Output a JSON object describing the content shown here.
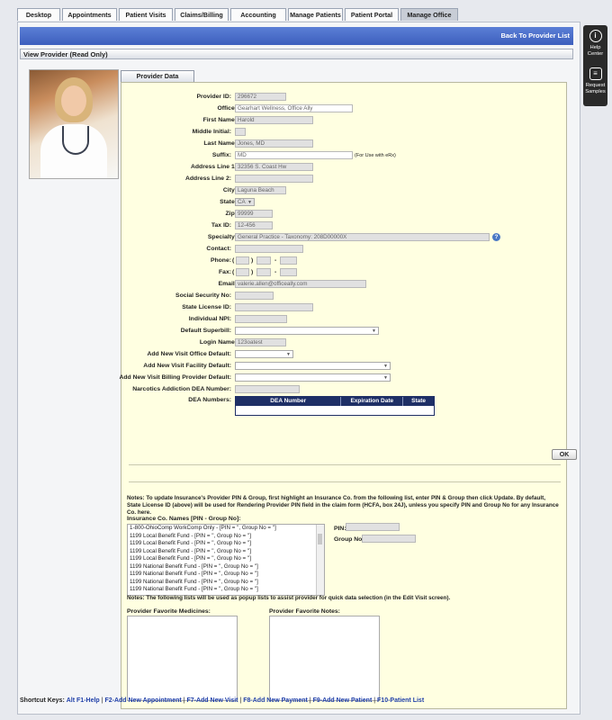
{
  "tabs": [
    "Desktop",
    "Appointments",
    "Patient Visits",
    "Claims/Billing",
    "Accounting",
    "Manage Patients",
    "Patient Portal",
    "Manage Office"
  ],
  "header": {
    "back_label": "Back To Provider List"
  },
  "section_title": "View Provider (Read Only)",
  "panel_tab": "Provider Data",
  "form": {
    "provider_id": {
      "label": "Provider ID:",
      "value": "296672"
    },
    "office": {
      "label": "Office:",
      "value": "Gearhart Wellness, Office Ally"
    },
    "first_name": {
      "label": "First Name:",
      "value": "Harold"
    },
    "middle_initial": {
      "label": "Middle Initial:",
      "value": ""
    },
    "last_name": {
      "label": "Last Name:",
      "value": "Jones, MD"
    },
    "suffix": {
      "label": "Suffix:",
      "value": "MD",
      "note": "(For Use with eRx)"
    },
    "address1": {
      "label": "Address Line 1:",
      "value": "32356 S. Coast Hw"
    },
    "address2": {
      "label": "Address Line 2:",
      "value": ""
    },
    "city": {
      "label": "City:",
      "value": "Laguna Beach"
    },
    "state": {
      "label": "State:",
      "value": "CA"
    },
    "zip": {
      "label": "Zip:",
      "value": "99999"
    },
    "tax_id": {
      "label": "Tax ID:",
      "value": "12-456"
    },
    "specialty": {
      "label": "Specialty:",
      "value": "General Practice - Taxonomy: 208D00000X"
    },
    "contact": {
      "label": "Contact:",
      "value": ""
    },
    "phone": {
      "label": "Phone:",
      "open": "(",
      "close": ")",
      "dash": "-"
    },
    "fax": {
      "label": "Fax:",
      "open": "(",
      "close": ")",
      "dash": "-"
    },
    "email": {
      "label": "Email:",
      "value": "valerie.allen@officeally.com"
    },
    "ssn": {
      "label": "Social Security No:",
      "value": ""
    },
    "state_license": {
      "label": "State License ID:",
      "value": ""
    },
    "npi": {
      "label": "Individual NPI:",
      "value": ""
    },
    "default_superbill": {
      "label": "Default Superbill:",
      "value": ""
    },
    "login_name": {
      "label": "Login Name:",
      "value": "123oatest"
    },
    "visit_office_default": {
      "label": "Add New Visit Office Default:",
      "value": ""
    },
    "visit_facility_default": {
      "label": "Add New Visit Facility Default:",
      "value": ""
    },
    "visit_billing_default": {
      "label": "Add New Visit Billing Provider Default:",
      "value": ""
    },
    "narcotics_dea": {
      "label": "Narcotics Addiction DEA Number:",
      "value": ""
    },
    "dea_numbers": {
      "label": "DEA Numbers:",
      "columns": [
        "DEA Number",
        "Expiration Date",
        "State"
      ]
    }
  },
  "required_mark": "*",
  "ok_label": "OK",
  "notes1": "Notes: To update Insurance's Provider PIN & Group, first highlight an Insurance Co. from the following list, enter PIN & Group then click Update. By default, State License ID (above) will be used for Rendering Provider PIN field in the claim form (HCFA, box 24J), unless you specify PIN and Group No for any Insurance Co. here.",
  "insurance": {
    "label": "Insurance Co. Names [PIN - Group No]:",
    "items": [
      "1-800-OhioComp WorkComp Only - [PIN = '', Group No = '']",
      "1199 Local Benefit Fund - [PIN = '', Group No = '']",
      "1199 Local Benefit Fund - [PIN = '', Group No = '']",
      "1199 Local Benefit Fund - [PIN = '', Group No = '']",
      "1199 Local Benefit Fund - [PIN = '', Group No = '']",
      "1199 National Benefit Fund - [PIN = '', Group No = '']",
      "1199 National Benefit Fund - [PIN = '', Group No = '']",
      "1199 National Benefit Fund - [PIN = '', Group No = '']",
      "1199 National Benefit Fund - [PIN = '', Group No = '']"
    ],
    "pin_label": "PIN:",
    "group_label": "Group No:"
  },
  "notes2": "Notes: The following lists will be used as popup lists to assist provider for quick data selection (in the Edit Visit screen).",
  "favorites": {
    "medicines_label": "Provider Favorite Medicines:",
    "notes_label": "Provider Favorite Notes:"
  },
  "side": {
    "help_line1": "Help",
    "help_line2": "Center",
    "req_line1": "Request",
    "req_line2": "Samples"
  },
  "footer": {
    "prefix": "Shortcut Keys:",
    "keys": [
      "Alt F1-Help",
      "F2-Add New Appointment",
      "F7-Add New Visit",
      "F8-Add New Payment",
      "F9-Add New Patient",
      "F10-Patient List"
    ],
    "sep": "|"
  }
}
